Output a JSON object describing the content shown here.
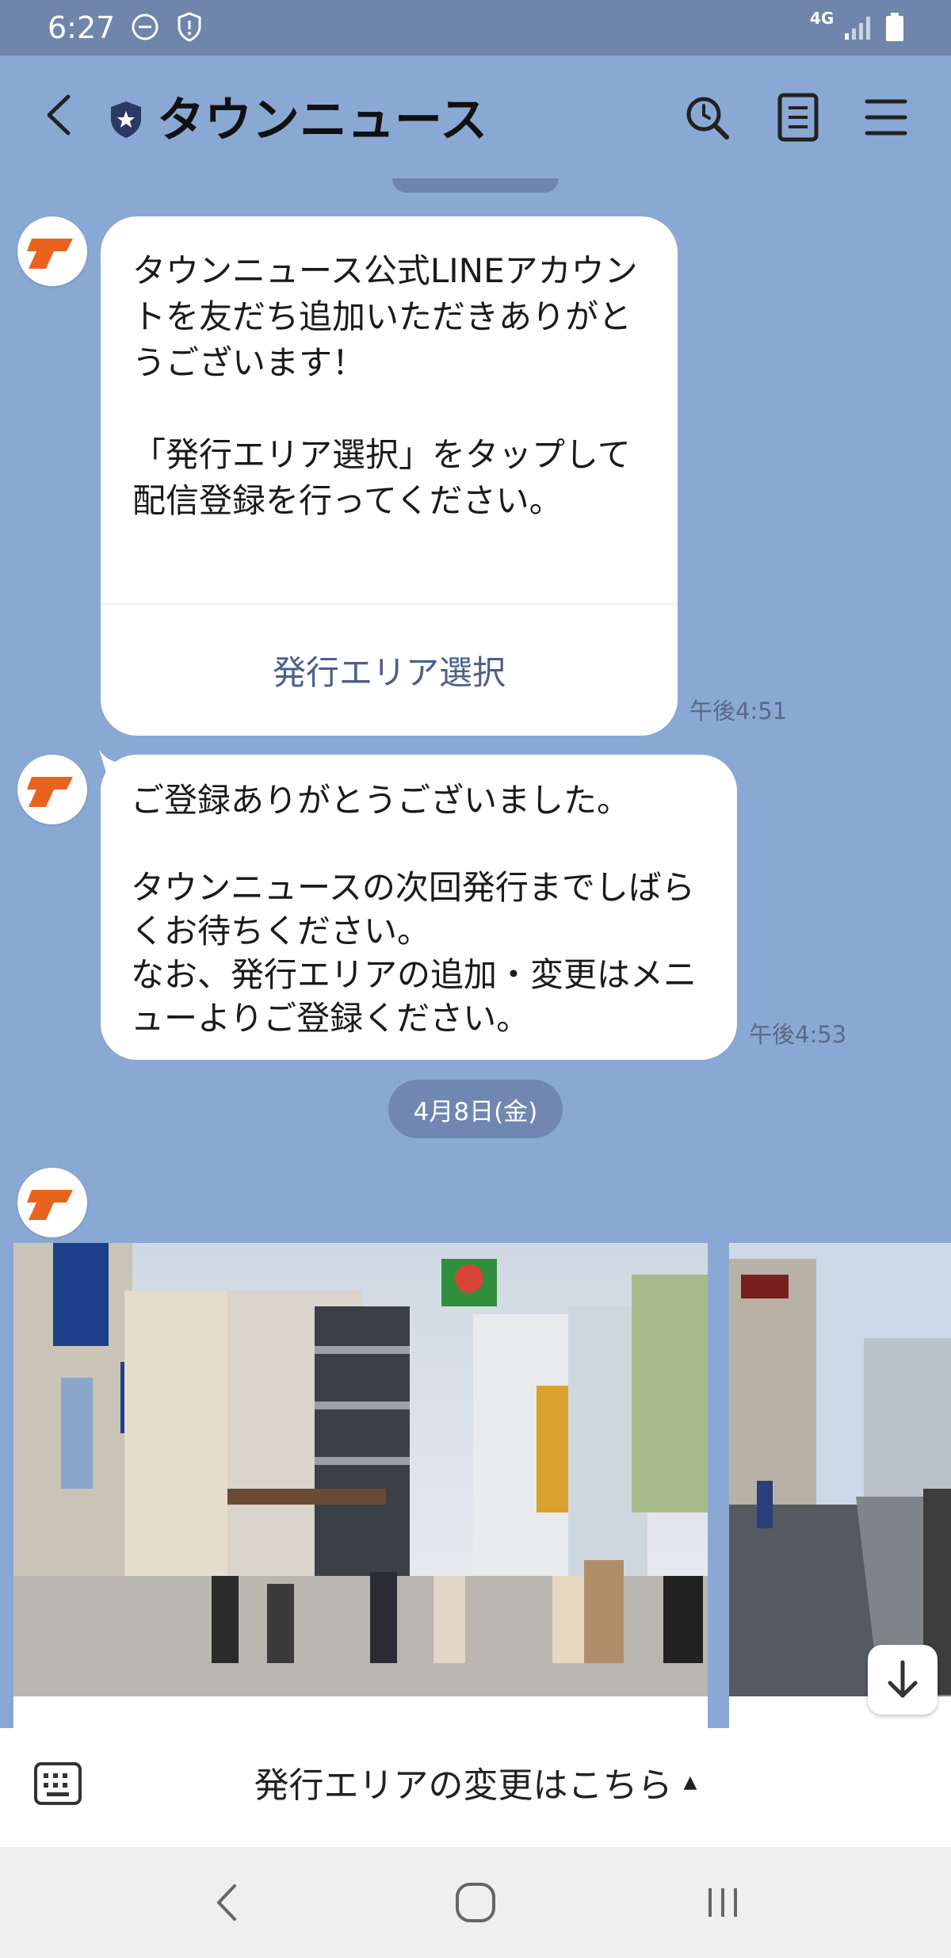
{
  "status_bar": {
    "time": "6:27",
    "network": "4G",
    "icons": [
      "do-not-disturb-icon",
      "shield-icon",
      "signal-icon",
      "battery-icon"
    ]
  },
  "header": {
    "title": "タウンニュース",
    "icons": [
      "back-icon",
      "official-shield-icon",
      "search-icon",
      "notes-icon",
      "menu-icon"
    ]
  },
  "messages": [
    {
      "text": "タウンニュース公式LINEアカウントを友だち追加いただきありがとうございます！\n\n「発行エリア選択」をタップして配信登録を行ってください。",
      "button_label": "発行エリア選択",
      "time": "午後4:51"
    },
    {
      "text": "ご登録ありがとうございました。\n\nタウンニュースの次回発行までしばらくお待ちください。\nなお、発行エリアの追加・変更はメニューよりご登録ください。",
      "time": "午後4:53"
    }
  ],
  "date_separator": "4月8日(金)",
  "rich_menu": {
    "label": "発行エリアの変更はこちら",
    "caret": "▲"
  },
  "colors": {
    "chat_background": "#8aa8d4",
    "status_bar": "#6f85ab",
    "brand_orange": "#e8641e",
    "link_text": "#4b5f8c"
  }
}
